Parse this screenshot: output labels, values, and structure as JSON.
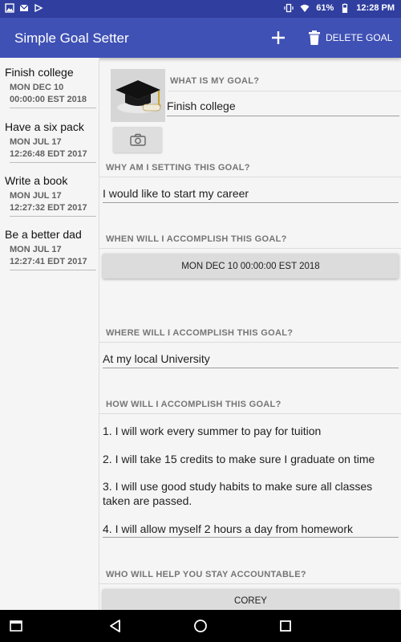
{
  "status_bar": {
    "battery": "61%",
    "time": "12:28 PM"
  },
  "app_bar": {
    "title": "Simple Goal Setter",
    "delete_label": "DELETE GOAL",
    "colors": {
      "primary": "#3F51B5",
      "primary_dark": "#303F9F"
    }
  },
  "goals": [
    {
      "title": "Finish college",
      "date_line1": "MON DEC 10",
      "date_line2": "00:00:00 EST 2018"
    },
    {
      "title": "Have a six pack",
      "date_line1": "MON JUL 17",
      "date_line2": "12:26:48 EDT 2017"
    },
    {
      "title": "Write a book",
      "date_line1": "MON JUL 17",
      "date_line2": "12:27:32 EDT 2017"
    },
    {
      "title": "Be a better dad",
      "date_line1": "MON JUL 17",
      "date_line2": "12:27:41 EDT 2017"
    }
  ],
  "form": {
    "what_label": "WHAT IS MY GOAL?",
    "what_value": "Finish college",
    "why_label": "WHY AM I SETTING THIS GOAL?",
    "why_value": "I would like to start my career",
    "when_label": "WHEN WILL I ACCOMPLISH THIS GOAL?",
    "when_value": "MON DEC 10 00:00:00 EST 2018",
    "where_label": "WHERE WILL I ACCOMPLISH THIS GOAL?",
    "where_value": "At my local University",
    "how_label": "HOW WILL I ACCOMPLISH THIS GOAL?",
    "how_items": [
      "1. I will work every summer to pay for tuition",
      "2. I will take 15 credits to make sure I graduate on time",
      "3. I will use good study habits to make sure all classes taken are passed.",
      "4. I will allow myself 2 hours a day from homework"
    ],
    "who_label": "WHO WILL HELP YOU STAY ACCOUNTABLE?",
    "who_value": "COREY"
  }
}
